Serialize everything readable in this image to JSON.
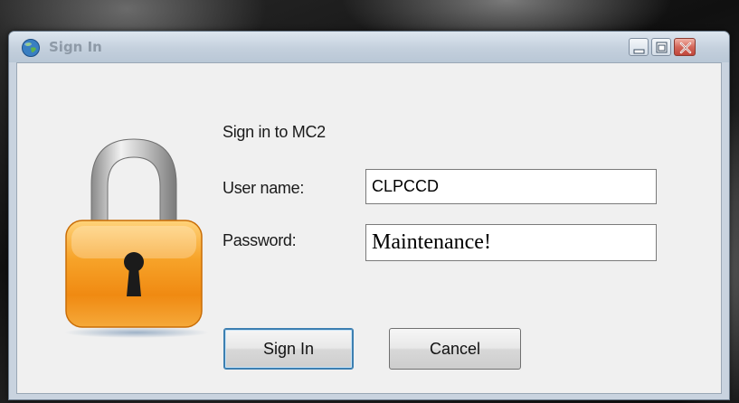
{
  "window": {
    "title": "Sign In",
    "controls": {
      "minimize": "minimize-icon",
      "maximize": "maximize-icon",
      "close": "close-icon"
    }
  },
  "dialog": {
    "heading": "Sign in to MC2",
    "username_label": "User name:",
    "username_value": "CLPCCD",
    "password_label": "Password:",
    "password_value": "Maintenance!",
    "signin_button": "Sign In",
    "cancel_button": "Cancel",
    "illustration": "padlock-icon"
  },
  "colors": {
    "lock_orange": "#f39a1e",
    "title_text": "#8e9aa7",
    "client_bg": "#f0f0f0"
  }
}
